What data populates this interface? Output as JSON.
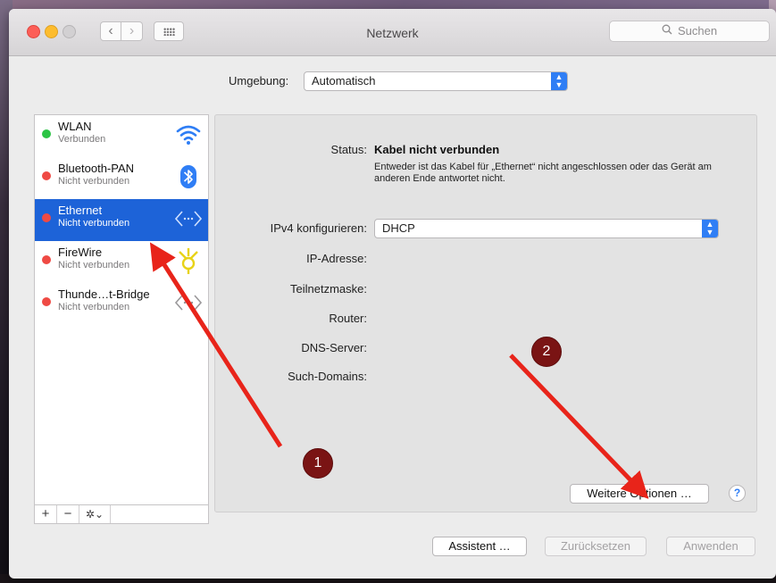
{
  "window": {
    "title": "Netzwerk"
  },
  "search": {
    "placeholder": "Suchen"
  },
  "location": {
    "label": "Umgebung:",
    "value": "Automatisch"
  },
  "sidebar": {
    "items": [
      {
        "name": "WLAN",
        "status": "Verbunden",
        "dot": "green",
        "icon": "wifi-icon"
      },
      {
        "name": "Bluetooth-PAN",
        "status": "Nicht verbunden",
        "dot": "red",
        "icon": "bluetooth-icon"
      },
      {
        "name": "Ethernet",
        "status": "Nicht verbunden",
        "dot": "red",
        "icon": "ethernet-icon",
        "selected": true
      },
      {
        "name": "FireWire",
        "status": "Nicht verbunden",
        "dot": "red",
        "icon": "firewire-icon"
      },
      {
        "name": "Thunde…t-Bridge",
        "status": "Nicht verbunden",
        "dot": "red",
        "icon": "thunderbolt-bridge-icon"
      }
    ],
    "tools": {
      "add": "+",
      "remove": "−",
      "action": "✲⌄"
    }
  },
  "detail": {
    "status_label": "Status:",
    "status_value": "Kabel nicht verbunden",
    "status_description": "Entweder ist das Kabel für „Ethernet“ nicht angeschlossen oder das Gerät am anderen Ende antwortet nicht.",
    "ipv4_label": "IPv4 konfigurieren:",
    "ipv4_value": "DHCP",
    "ip_label": "IP-Adresse:",
    "subnet_label": "Teilnetzmaske:",
    "router_label": "Router:",
    "dns_label": "DNS-Server:",
    "domains_label": "Such-Domains:"
  },
  "buttons": {
    "advanced": "Weitere Optionen …",
    "help": "?",
    "assistant": "Assistent …",
    "revert": "Zurücksetzen",
    "apply": "Anwenden"
  },
  "annotations": {
    "badge1": "1",
    "badge2": "2"
  },
  "colors": {
    "accent": "#2f7ef5",
    "selection": "#1d63d8",
    "arrow": "#e8241a",
    "badge": "#7a1414"
  }
}
